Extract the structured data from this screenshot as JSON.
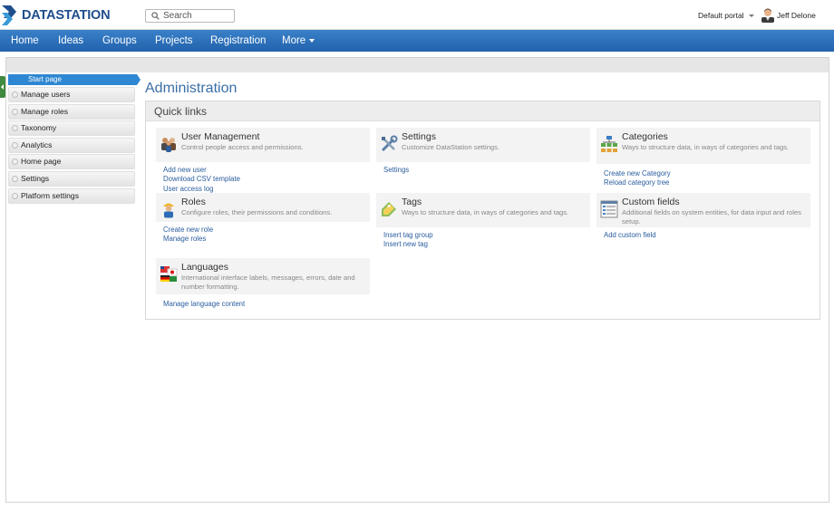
{
  "app": {
    "brand": "DATASTATION"
  },
  "search": {
    "placeholder": "Search"
  },
  "header": {
    "portal": "Default portal",
    "user_name": "Jeff Delone"
  },
  "nav": {
    "items": [
      "Home",
      "Ideas",
      "Groups",
      "Projects",
      "Registration",
      "More"
    ]
  },
  "sidebar": {
    "start": "Start page",
    "items": [
      "Manage users",
      "Manage roles",
      "Taxonomy",
      "Analytics",
      "Home page",
      "Settings",
      "Platform settings"
    ]
  },
  "main": {
    "title": "Administration",
    "panel_title": "Quick links",
    "cards": [
      {
        "title": "User Management",
        "desc": "Control people access and permissions.",
        "icon": "users-icon",
        "links": [
          "Add new user",
          "Download CSV template",
          "User access log"
        ]
      },
      {
        "title": "Settings",
        "desc": "Customize DataStation settings.",
        "icon": "tools-icon",
        "links": [
          "Settings"
        ]
      },
      {
        "title": "Categories",
        "desc": "Ways to structure data, in ways of categories and tags.",
        "icon": "hierarchy-icon",
        "links": [
          "Create new Category",
          "Reload category tree"
        ]
      },
      {
        "title": "Roles",
        "desc": "Configure roles, their permissions and conditions.",
        "icon": "worker-icon",
        "links": [
          "Create new role",
          "Manage roles"
        ]
      },
      {
        "title": "Tags",
        "desc": "Ways to structure data, in ways of categories and tags.",
        "icon": "tag-icon",
        "links": [
          "Insert tag group",
          "Insert new tag"
        ]
      },
      {
        "title": "Custom fields",
        "desc": "Additional fields on system entities, for data input and roles setup.",
        "icon": "form-icon",
        "links": [
          "Add custom field"
        ]
      },
      {
        "title": "Languages",
        "desc": "International interface labels, messages, errors, date and number formatting.",
        "icon": "flags-icon",
        "links": [
          "Manage language content"
        ]
      }
    ]
  },
  "colors": {
    "brand": "#1f4e8c",
    "nav_bg": "#2a6db8",
    "link": "#2a5d9e",
    "title": "#3a6ea5",
    "start_bg": "#2e87d3",
    "toggle": "#3f8a3f"
  }
}
